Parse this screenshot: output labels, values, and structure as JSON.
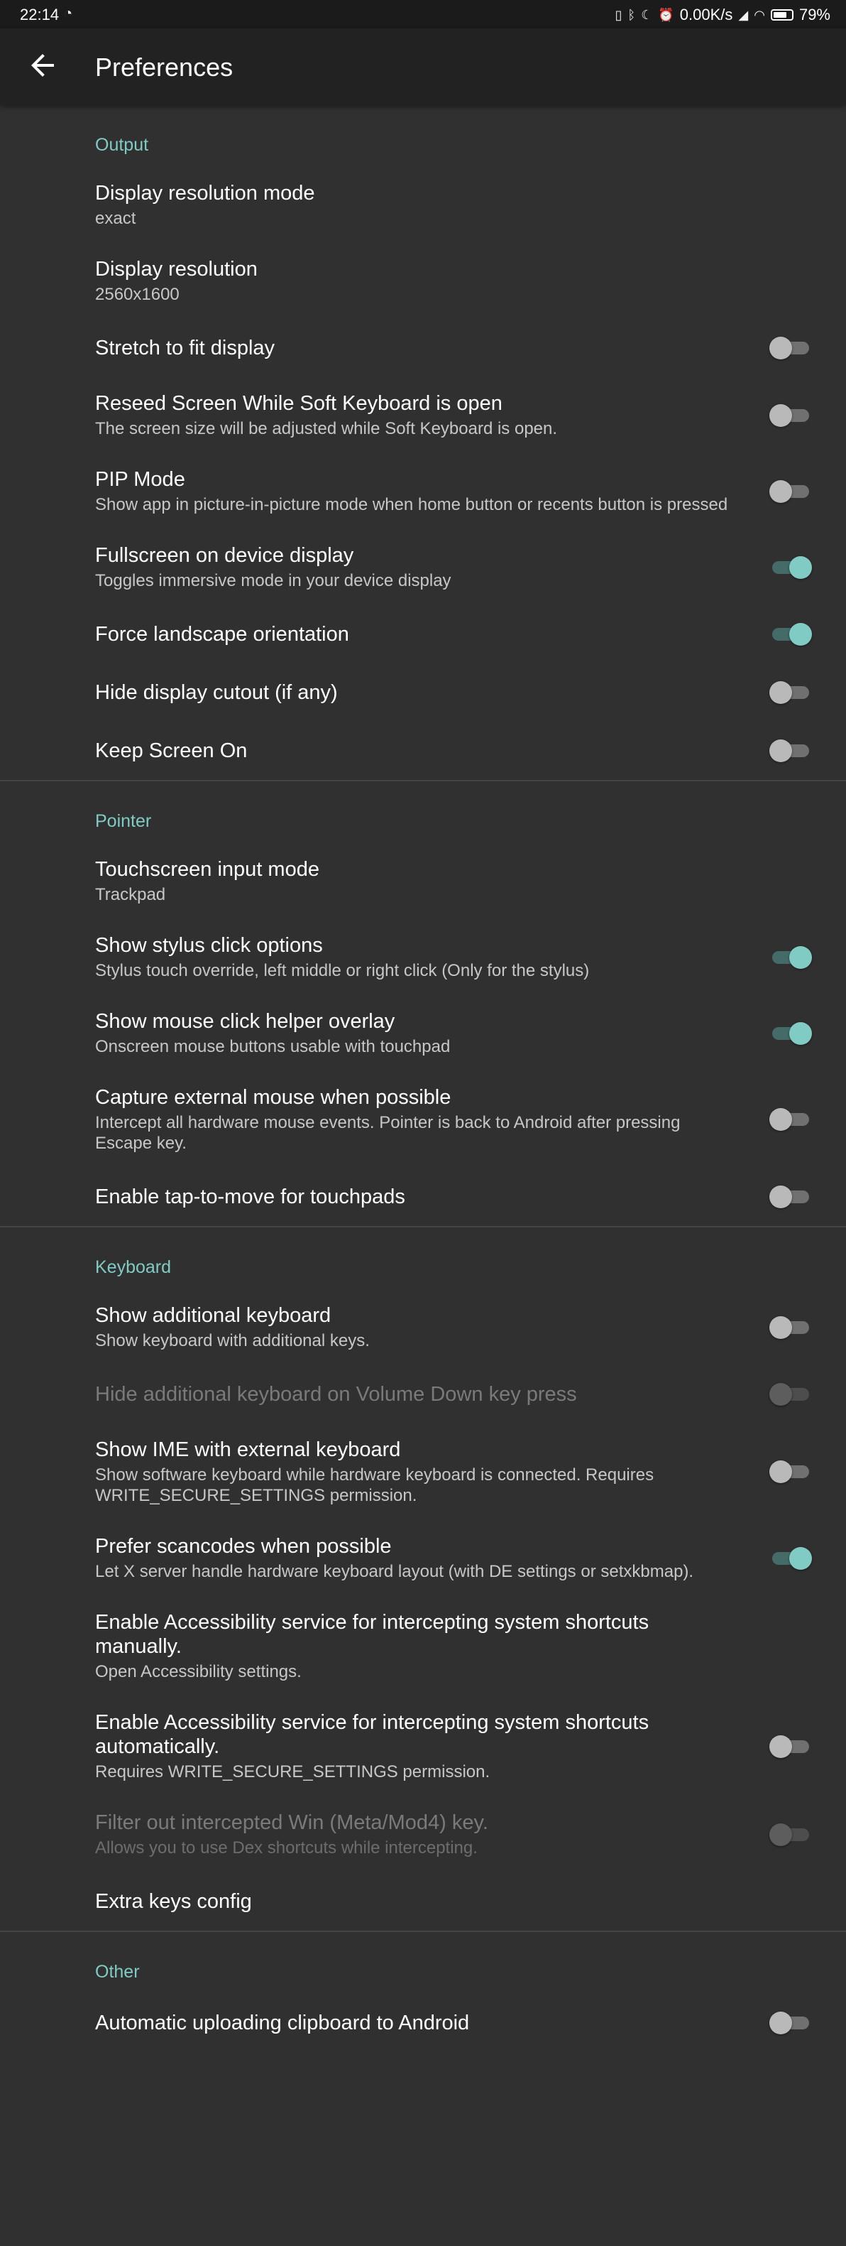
{
  "status": {
    "time": "22:14",
    "net_speed": "0.00K/s",
    "battery": "79%"
  },
  "appbar": {
    "title": "Preferences",
    "back_icon": "arrow-back-icon"
  },
  "sections": {
    "output": {
      "header": "Output",
      "items": [
        {
          "title": "Display resolution mode",
          "summary": "exact"
        },
        {
          "title": "Display resolution",
          "summary": "2560x1600"
        },
        {
          "title": "Stretch to fit display",
          "toggle": false
        },
        {
          "title": "Reseed Screen While Soft Keyboard is open",
          "summary": "The screen size will be adjusted while Soft Keyboard is open.",
          "toggle": false
        },
        {
          "title": "PIP Mode",
          "summary": "Show app in picture-in-picture mode when home button or recents button is pressed",
          "toggle": false
        },
        {
          "title": "Fullscreen on device display",
          "summary": "Toggles immersive mode in your device display",
          "toggle": true
        },
        {
          "title": "Force landscape orientation",
          "toggle": true
        },
        {
          "title": "Hide display cutout (if any)",
          "toggle": false
        },
        {
          "title": "Keep Screen On",
          "toggle": false
        }
      ]
    },
    "pointer": {
      "header": "Pointer",
      "items": [
        {
          "title": "Touchscreen input mode",
          "summary": "Trackpad"
        },
        {
          "title": "Show stylus click options",
          "summary": "Stylus touch override, left middle or right click (Only for the stylus)",
          "toggle": true
        },
        {
          "title": "Show mouse click helper overlay",
          "summary": "Onscreen mouse buttons usable with touchpad",
          "toggle": true
        },
        {
          "title": "Capture external mouse when possible",
          "summary": "Intercept all hardware mouse events. Pointer is back to Android after pressing Escape key.",
          "toggle": false
        },
        {
          "title": "Enable tap-to-move for touchpads",
          "toggle": false
        }
      ]
    },
    "keyboard": {
      "header": "Keyboard",
      "items": [
        {
          "title": "Show additional keyboard",
          "summary": "Show keyboard with additional keys.",
          "toggle": false
        },
        {
          "title": "Hide additional keyboard on Volume Down key press",
          "toggle": false,
          "disabled": true
        },
        {
          "title": "Show IME with external keyboard",
          "summary": "Show software keyboard while hardware keyboard is connected. Requires WRITE_SECURE_SETTINGS permission.",
          "toggle": false
        },
        {
          "title": "Prefer scancodes when possible",
          "summary": "Let X server handle hardware keyboard layout (with DE settings or setxkbmap).",
          "toggle": true
        },
        {
          "title": "Enable Accessibility service for intercepting system shortcuts manually.",
          "summary": "Open Accessibility settings."
        },
        {
          "title": "Enable Accessibility service for intercepting system shortcuts automatically.",
          "summary": "Requires WRITE_SECURE_SETTINGS permission.",
          "toggle": false
        },
        {
          "title": "Filter out intercepted Win (Meta/Mod4) key.",
          "summary": "Allows you to use Dex shortcuts while intercepting.",
          "toggle": false,
          "disabled": true
        },
        {
          "title": "Extra keys config"
        }
      ]
    },
    "other": {
      "header": "Other",
      "items": [
        {
          "title": "Automatic uploading clipboard to Android",
          "toggle": false
        }
      ]
    }
  }
}
